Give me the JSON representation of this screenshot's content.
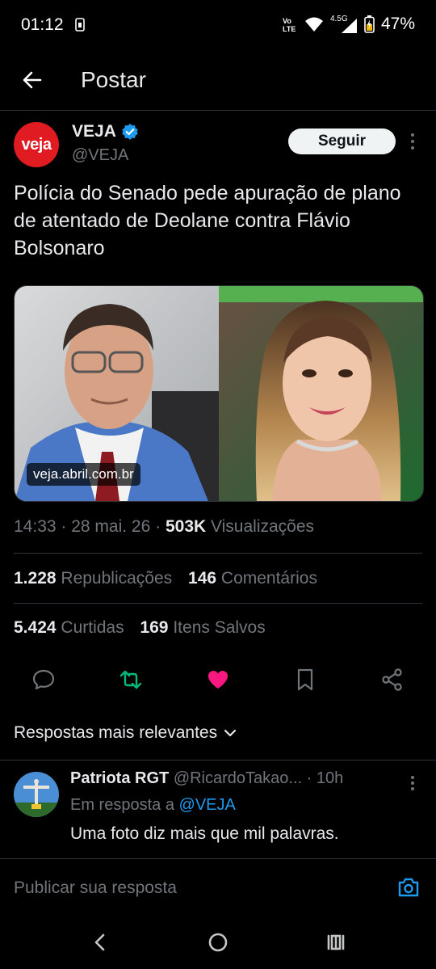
{
  "status_bar": {
    "time": "01:12",
    "network": "4.5G",
    "battery": "47%",
    "icons": [
      "sim-icon",
      "volte-icon",
      "wifi-icon",
      "signal-icon",
      "battery-icon"
    ]
  },
  "header": {
    "title": "Postar"
  },
  "post": {
    "author_name": "VEJA",
    "author_handle": "@VEJA",
    "avatar_text": "veja",
    "follow_label": "Seguir",
    "text": "Polícia do Senado pede apuração de plano de atentado de Deolane contra Flávio Bolsonaro",
    "media_link": "veja.abril.com.br",
    "time": "14:33",
    "date": "28 mai. 26",
    "views_count": "503K",
    "views_label": "Visualizações",
    "reposts_count": "1.228",
    "reposts_label": "Republicações",
    "comments_count": "146",
    "comments_label": "Comentários",
    "likes_count": "5.424",
    "likes_label": "Curtidas",
    "saves_count": "169",
    "saves_label": "Itens Salvos"
  },
  "colors": {
    "accent": "#1d9bf0",
    "repost": "#00ba7c",
    "like": "#f91880",
    "brand_red": "#e01b22"
  },
  "replies": {
    "sort_label": "Respostas mais relevantes",
    "items": [
      {
        "name": "Patriota RGT",
        "handle": "@RicardoTakao...",
        "time": "· 10h",
        "reply_to_label": "Em resposta a",
        "reply_to_handle": "@VEJA",
        "text": "Uma foto diz mais que mil palavras."
      }
    ]
  },
  "composer": {
    "placeholder": "Publicar sua resposta"
  }
}
